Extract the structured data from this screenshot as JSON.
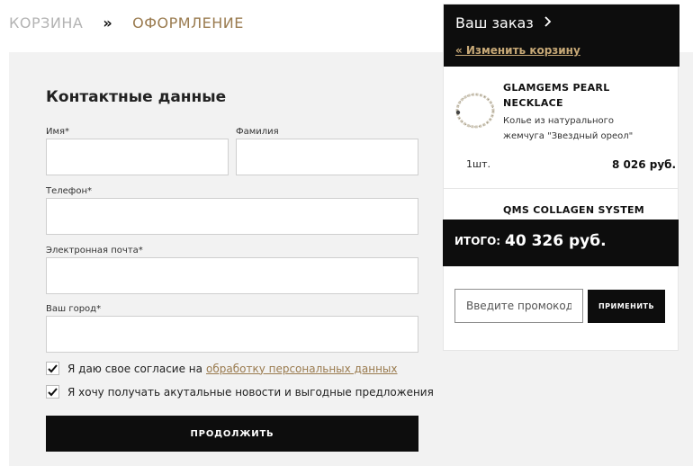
{
  "breadcrumb": {
    "cart": "КОРЗИНА",
    "separator": "»",
    "current": "ОФОРМЛЕНИЕ"
  },
  "contact": {
    "title": "Контактные данные",
    "first_name_label": "Имя*",
    "first_name_value": "",
    "last_name_label": "Фамилия",
    "last_name_value": "",
    "phone_label": "Телефон*",
    "phone_value": "",
    "email_label": "Электронная почта*",
    "email_value": "",
    "city_label": "Ваш город*",
    "city_value": ""
  },
  "consents": {
    "personal_data_text": "Я даю свое согласие на",
    "personal_data_link": "обработку персональных данных",
    "personal_data_checked": true,
    "news_text": "Я хочу получать акутальные новости и выгодные предложения",
    "news_checked": true
  },
  "continue_label": "ПРОДОЛЖИТЬ",
  "order": {
    "title": "Ваш заказ",
    "change_cart": "« Изменить корзину",
    "items": [
      {
        "name": "GLAMGEMS PEARL NECKLACE",
        "description": "Колье из натурального жемчуга \"Звездный ореол\"",
        "qty": "1шт.",
        "price": "8 026 руб.",
        "icon": "pearl-necklace-image"
      },
      {
        "name": "QMS COLLAGEN SYSTEM"
      }
    ],
    "total_label": "ИТОГО:",
    "total_value": "40 326 руб.",
    "promo_placeholder": "Введите промокод",
    "apply_label": "ПРИМЕНИТЬ"
  },
  "colors": {
    "accent": "#9a7b4f",
    "link_light": "#c8a977",
    "dark": "#0d0d0d",
    "panel": "#f2f2f2"
  }
}
